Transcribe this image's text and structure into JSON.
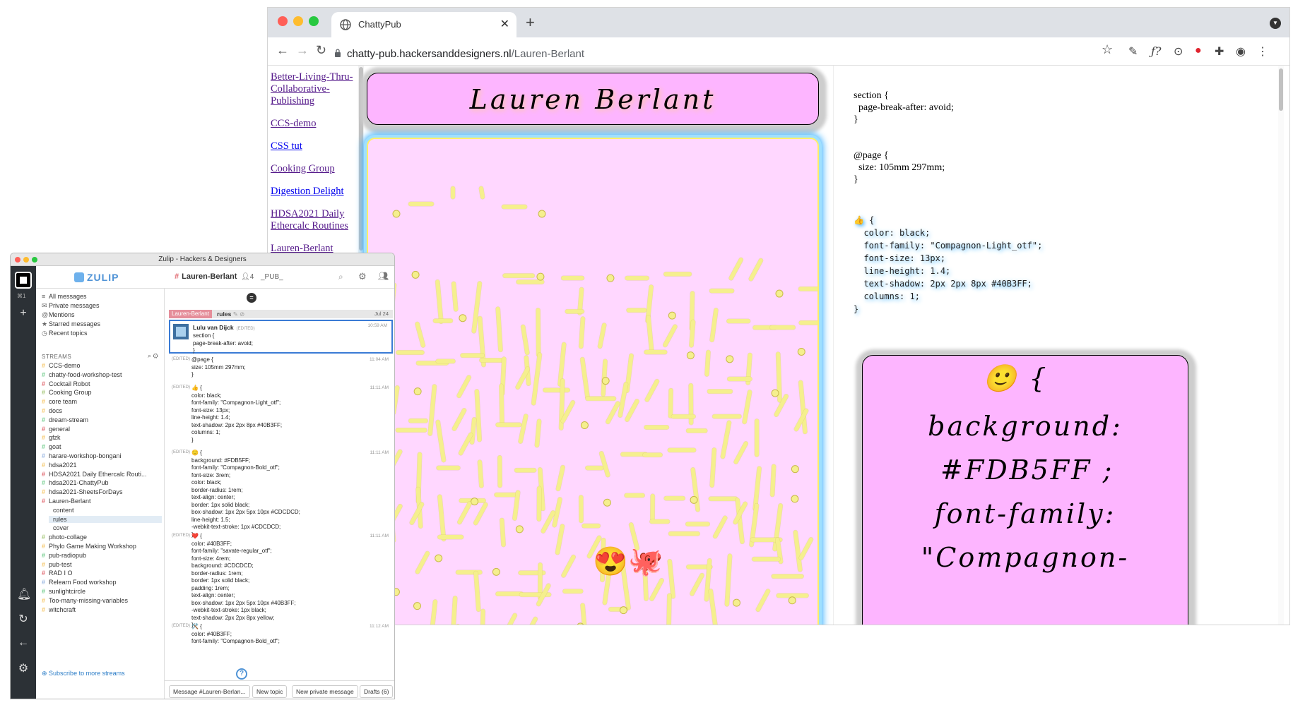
{
  "browser": {
    "tab_title": "ChattyPub",
    "tab_close": "✕",
    "new_tab": "+",
    "url_host": "chatty-pub.hackersanddesigners.nl",
    "url_path": "/Lauren-Berlant",
    "colors": {
      "tabbar": "#dee1e6",
      "traffic_red": "#ff5f57",
      "traffic_yellow": "#febc2e",
      "traffic_green": "#28c840"
    }
  },
  "site_nav": [
    {
      "label": "Better-Living-Thru-Collaborative-Publishing",
      "visited": true
    },
    {
      "label": "CCS-demo",
      "visited": true
    },
    {
      "label": "CSS tut",
      "visited": false
    },
    {
      "label": "Cooking Group",
      "visited": true
    },
    {
      "label": "Digestion Delight",
      "visited": false
    },
    {
      "label": "HDSA2021 Daily Ethercalc Routines",
      "visited": true
    },
    {
      "label": "Lauren-Berlant",
      "visited": true
    }
  ],
  "preview": {
    "title": "Lauren Berlant",
    "emojis": "😍🐙",
    "colors": {
      "card_bg": "#fdb5ff",
      "glyph": "#f5ef8e",
      "shadow": "#40b3ff"
    }
  },
  "css_panel": {
    "plain": "section {\n  page-break-after: avoid;\n}\n\n\n@page {\n  size: 105mm 297mm;\n}",
    "rule": "👍 {\n  color: black;\n  font-family: \"Compagnon-Light_otf\";\n  font-size: 13px;\n  line-height: 1.4;\n  text-shadow: 2px 2px 8px #40B3FF;\n  columns: 1;\n}",
    "card_lines": [
      "🙂  {",
      "background:",
      "#FDB5FF ;",
      "font-family:",
      "\"Compagnon-"
    ]
  },
  "zulip": {
    "window_title": "Zulip - Hackers & Designers",
    "logo": "ZULIP",
    "stream": "Lauren-Berlant",
    "subscriber_count": "4",
    "stream_desc": "_PUB_",
    "nav": [
      "All messages",
      "Private messages",
      "Mentions",
      "Starred messages",
      "Recent topics"
    ],
    "streams_heading": "STREAMS",
    "streams": [
      {
        "name": "CCS-demo",
        "color": "#f5c76b"
      },
      {
        "name": "chatty-food-workshop-test",
        "color": "#76ce90"
      },
      {
        "name": "Cocktail Robot",
        "color": "#e0676f"
      },
      {
        "name": "Cooking Group",
        "color": "#a6c77a"
      },
      {
        "name": "core team",
        "color": "#f5c76b"
      },
      {
        "name": "docs",
        "color": "#f5c76b"
      },
      {
        "name": "dream-stream",
        "color": "#76ce90"
      },
      {
        "name": "general",
        "color": "#e0676f"
      },
      {
        "name": "gfzk",
        "color": "#f5c76b"
      },
      {
        "name": "goat",
        "color": "#76ce90"
      },
      {
        "name": "harare-workshop-bongani",
        "color": "#9bb7e2"
      },
      {
        "name": "hdsa2021",
        "color": "#f5c76b"
      },
      {
        "name": "HDSA2021 Daily Ethercalc Routi...",
        "color": "#e0676f"
      },
      {
        "name": "hdsa2021-ChattyPub",
        "color": "#76ce90"
      },
      {
        "name": "hdsa2021-SheetsForDays",
        "color": "#f5c76b"
      },
      {
        "name": "Lauren-Berlant",
        "color": "#e0676f"
      }
    ],
    "topics": [
      "content",
      "rules",
      "cover"
    ],
    "streams_after": [
      {
        "name": "photo-collage",
        "color": "#a6c77a"
      },
      {
        "name": "Phylo Game Making Workshop",
        "color": "#f5c76b"
      },
      {
        "name": "pub-radiopub",
        "color": "#76ce90"
      },
      {
        "name": "pub-test",
        "color": "#f5c76b"
      },
      {
        "name": "RAD I O",
        "color": "#e0676f"
      },
      {
        "name": "Relearn Food workshop",
        "color": "#9bb7e2"
      },
      {
        "name": "sunlightcircle",
        "color": "#76ce90"
      },
      {
        "name": "Too-many-missing-variables",
        "color": "#f5c76b"
      },
      {
        "name": "witchcraft",
        "color": "#f5c76b"
      }
    ],
    "subscribe": "Subscribe to more streams",
    "recipient": {
      "stream": "Lauren-Berlant",
      "topic": "rules",
      "date": "Jul 24"
    },
    "messages": [
      {
        "sender": "Lulu van Dijck",
        "edited": "(EDITED)",
        "time": "10:59 AM",
        "body": "section {\npage-break-after: avoid;\n}"
      },
      {
        "edited": "(EDITED)",
        "time": "11:04 AM",
        "body": "@page {\nsize: 105mm 297mm;\n}"
      },
      {
        "edited": "(EDITED)",
        "time": "11:11 AM",
        "body": "👍 {\ncolor: black;\nfont-family: \"Compagnon-Light_otf\";\nfont-size: 13px;\nline-height: 1.4;\ntext-shadow: 2px 2px 8px #40B3FF;\ncolumns: 1;\n}"
      },
      {
        "edited": "(EDITED)",
        "time": "11:11 AM",
        "body": "🙂 {\nbackground: #FDB5FF;\nfont-family: \"Compagnon-Bold_otf\";\nfont-size: 3rem;\ncolor: black;\nborder-radius: 1rem;\ntext-align: center;\nborder: 1px solid black;\nbox-shadow: 1px 2px 5px 10px #CDCDCD;\nline-height: 1.5;\n-webkit-text-stroke: 1px #CDCDCD;\n}"
      },
      {
        "edited": "(EDITED)",
        "time": "11:11 AM",
        "body": "❤️ {\ncolor: #40B3FF;\nfont-family: \"savate-regular_otf\";\nfont-size: 4rem;\nbackground: #CDCDCD;\nborder-radius: 1rem;\nborder: 1px solid black;\npadding: 1rem;\ntext-align: center;\nbox-shadow: 1px 2px 5px 10px #40B3FF;\n-webkit-text-stroke: 1px black;\ntext-shadow: 2px 2px 8px yellow;\n}"
      },
      {
        "edited": "(EDITED)",
        "time": "11:12 AM",
        "body": "🛠️ {\ncolor: #40B3FF;\nfont-family: \"Compagnon-Bold_otf\";"
      }
    ],
    "compose": {
      "message": "Message #Lauren-Berlan...",
      "new_topic": "New topic",
      "new_pm": "New private message",
      "drafts": "Drafts (6)"
    }
  }
}
